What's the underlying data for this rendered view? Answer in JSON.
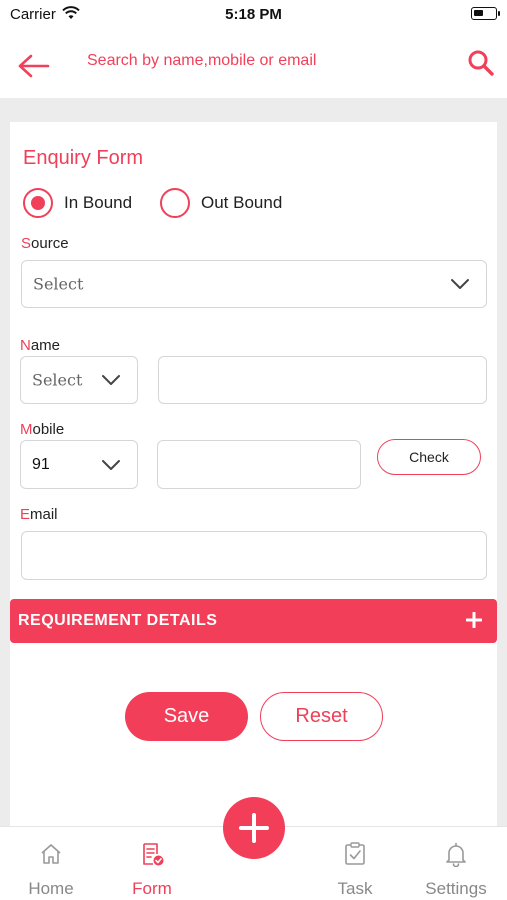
{
  "status_bar": {
    "carrier": "Carrier",
    "time": "5:18 PM"
  },
  "header": {
    "search_placeholder": "Search by name,mobile or email",
    "back_icon": "arrow-left-icon",
    "search_icon": "search-icon"
  },
  "form": {
    "title": "Enquiry Form",
    "direction_options": [
      {
        "label": "In Bound",
        "selected": true
      },
      {
        "label": "Out Bound",
        "selected": false
      }
    ],
    "source": {
      "label_first": "S",
      "label_rest": "ource",
      "value": "Select"
    },
    "name": {
      "label_first": "N",
      "label_rest": "ame",
      "prefix_value": "Select",
      "value": ""
    },
    "mobile": {
      "label_first": "M",
      "label_rest": "obile",
      "country_code": "91",
      "value": "",
      "check_label": "Check"
    },
    "email": {
      "label_first": "E",
      "label_rest": "mail",
      "value": ""
    }
  },
  "requirement": {
    "label": "REQUIREMENT DETAILS"
  },
  "actions": {
    "save": "Save",
    "reset": "Reset"
  },
  "tabs": [
    {
      "label": "Home",
      "icon": "home-icon",
      "active": false
    },
    {
      "label": "Form",
      "icon": "form-icon",
      "active": true
    },
    {
      "label": "Task",
      "icon": "task-icon",
      "active": false
    },
    {
      "label": "Settings",
      "icon": "bell-icon",
      "active": false
    }
  ],
  "colors": {
    "accent": "#f23e58",
    "background": "#ececec"
  }
}
